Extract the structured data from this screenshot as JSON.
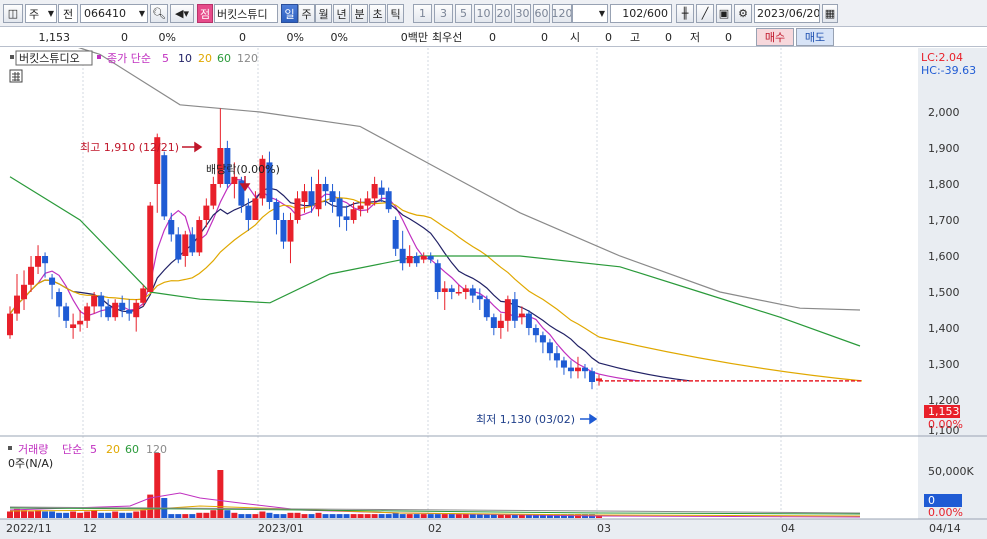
{
  "toolbar": {
    "market": "주",
    "period_mode": "전",
    "code": "066410",
    "stock_badge": "점",
    "stock_name": "버킷스튜디",
    "periods": [
      "일",
      "주",
      "월",
      "년",
      "분",
      "초",
      "틱"
    ],
    "active_period": "일",
    "minute_values": [
      "1",
      "3",
      "5",
      "10",
      "20",
      "30",
      "60",
      "120"
    ],
    "count": "102",
    "count_total": "/600",
    "date": "2023/06/20"
  },
  "info": {
    "price": "1,153",
    "change": "0",
    "change_pct": "0%",
    "volume": "0",
    "volume_pct": "0%",
    "rate": "0%",
    "amount": "0백만",
    "best_label": "최우선",
    "best_ask": "0",
    "best_bid": "0",
    "open_label": "시",
    "open": "0",
    "high_label": "고",
    "high": "0",
    "low_label": "저",
    "low": "0",
    "buy_label": "매수",
    "sell_label": "매도"
  },
  "colors": {
    "up": "#e8202a",
    "down": "#1f5bd4",
    "ma5": "#c030c0",
    "ma10": "#222266",
    "ma20": "#e0a800",
    "ma60": "#2a9a3a",
    "ma120": "#8a8a8a",
    "axis_bg": "#e9edf2"
  },
  "chart_data": [
    {
      "type": "candlestick",
      "legend": {
        "name": "버킷스튜디오",
        "ma_label": "종가 단순",
        "periods": [
          "5",
          "10",
          "20",
          "60",
          "120"
        ]
      },
      "lc_label": "LC:2.04",
      "hc_label": "HC:-39.63",
      "ylim": [
        1090,
        2180
      ],
      "y_ticks": [
        "2,000",
        "1,900",
        "1,800",
        "1,700",
        "1,600",
        "1,500",
        "1,400",
        "1,300",
        "1,200",
        "1,100"
      ],
      "current_price_label": "1,153",
      "current_pct_label": "0.00%",
      "annotations": {
        "high": "최고 1,910 (12/21)",
        "dividend": "배당락(0.00%)",
        "low": "최저 1,130 (03/02)"
      },
      "x_labels": [
        "2022/11",
        "12",
        "2023/01",
        "02",
        "03",
        "04",
        "04/14"
      ],
      "last_price": 1153
    },
    {
      "type": "bar",
      "legend": {
        "name": "거래량",
        "ma_label": "단순",
        "periods": [
          "5",
          "20",
          "60",
          "120"
        ]
      },
      "sub_label": "0주(N/A)",
      "y_ticks": [
        "50,000K"
      ],
      "current_label": "0",
      "current_pct_label": "0.00%"
    }
  ]
}
